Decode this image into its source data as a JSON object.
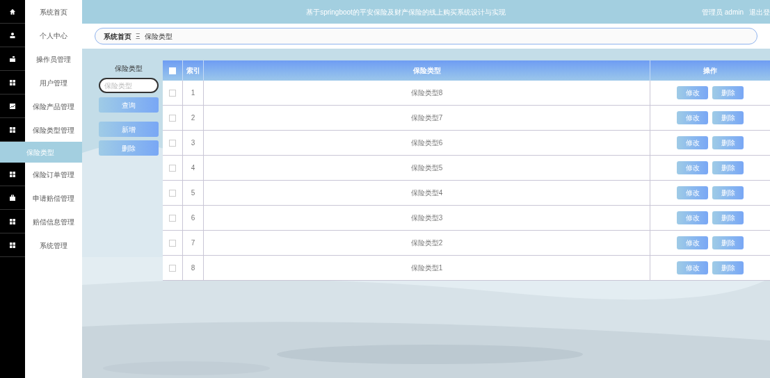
{
  "header": {
    "title": "基于springboot的平安保险及财产保险的线上购买系统设计与实现",
    "user": "管理员 admin",
    "logout": "退出登"
  },
  "sidebar": {
    "items": [
      {
        "label": "系统首页",
        "kind": "menu",
        "selected": false
      },
      {
        "label": "个人中心",
        "kind": "menu",
        "selected": false
      },
      {
        "label": "操作员管理",
        "kind": "menu",
        "selected": false
      },
      {
        "label": "用户管理",
        "kind": "menu",
        "selected": false
      },
      {
        "label": "保险产品管理",
        "kind": "menu",
        "selected": false
      },
      {
        "label": "保险类型管理",
        "kind": "menu",
        "selected": false
      },
      {
        "label": "保险类型",
        "kind": "submenu",
        "selected": true
      },
      {
        "label": "保险订单管理",
        "kind": "menu",
        "selected": false
      },
      {
        "label": "申请赔偿管理",
        "kind": "menu",
        "selected": false
      },
      {
        "label": "赔偿信息管理",
        "kind": "menu",
        "selected": false
      },
      {
        "label": "系统管理",
        "kind": "menu",
        "selected": false
      }
    ]
  },
  "breadcrumb": {
    "items": [
      "系统首页",
      "保险类型"
    ],
    "separator": "Ξ"
  },
  "search": {
    "label": "保险类型",
    "placeholder": "保险类型",
    "button": "查询"
  },
  "actions": [
    "新增",
    "删除"
  ],
  "table": {
    "header_checked": false,
    "columns": [
      "索引",
      "保险类型",
      "操作"
    ],
    "rows": [
      {
        "checked": false,
        "index": "1",
        "type": "保险类型8",
        "actions": [
          "修改",
          "删除"
        ]
      },
      {
        "checked": false,
        "index": "2",
        "type": "保险类型7",
        "actions": [
          "修改",
          "删除"
        ]
      },
      {
        "checked": false,
        "index": "3",
        "type": "保险类型6",
        "actions": [
          "修改",
          "删除"
        ]
      },
      {
        "checked": false,
        "index": "4",
        "type": "保险类型5",
        "actions": [
          "修改",
          "删除"
        ]
      },
      {
        "checked": false,
        "index": "5",
        "type": "保险类型4",
        "actions": [
          "修改",
          "删除"
        ]
      },
      {
        "checked": false,
        "index": "6",
        "type": "保险类型3",
        "actions": [
          "修改",
          "删除"
        ]
      },
      {
        "checked": false,
        "index": "7",
        "type": "保险类型2",
        "actions": [
          "修改",
          "删除"
        ]
      },
      {
        "checked": false,
        "index": "8",
        "type": "保险类型1",
        "actions": [
          "修改",
          "删除"
        ]
      }
    ]
  }
}
